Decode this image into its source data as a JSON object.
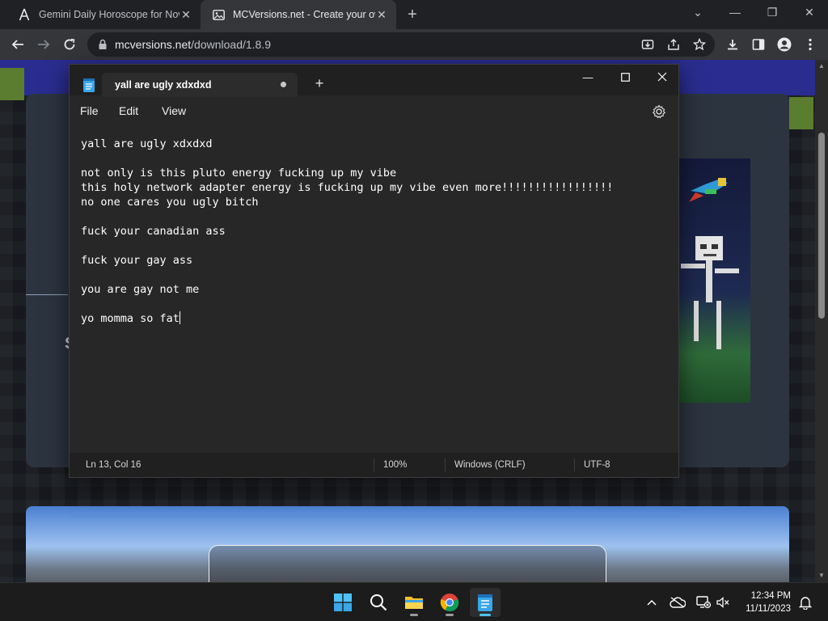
{
  "browser": {
    "tabs": [
      {
        "title": "Gemini Daily Horoscope for Nov",
        "icon": "a-letter-favicon",
        "active": false
      },
      {
        "title": "MCVersions.net - Create your ow",
        "icon": "image-favicon",
        "active": true
      }
    ],
    "address": {
      "host": "mcversions.net",
      "path": "/download/1.8.9"
    }
  },
  "page": {
    "fragments": [
      "S"
    ]
  },
  "notepad": {
    "tab_title": "yall are ugly xdxdxd",
    "menus": [
      "File",
      "Edit",
      "View"
    ],
    "lines": [
      "yall are ugly xdxdxd",
      "",
      "not only is this pluto energy fucking up my vibe",
      "this holy network adapter energy is fucking up my vibe even more!!!!!!!!!!!!!!!!!",
      "no one cares you ugly bitch",
      "",
      "fuck your canadian ass",
      "",
      "fuck your gay ass",
      "",
      "you are gay not me",
      "",
      "yo momma so fat"
    ],
    "status": {
      "position": "Ln 13, Col 16",
      "zoom": "100%",
      "line_ending": "Windows (CRLF)",
      "encoding": "UTF-8"
    }
  },
  "taskbar": {
    "apps": [
      "start",
      "search",
      "file-explorer",
      "chrome",
      "notepad"
    ],
    "time": "12:34 PM",
    "date": "11/11/2023"
  },
  "colors": {
    "accent": "#4cc2ff",
    "notepad_bg": "#272727",
    "chrome_toolbar": "#35363a"
  }
}
